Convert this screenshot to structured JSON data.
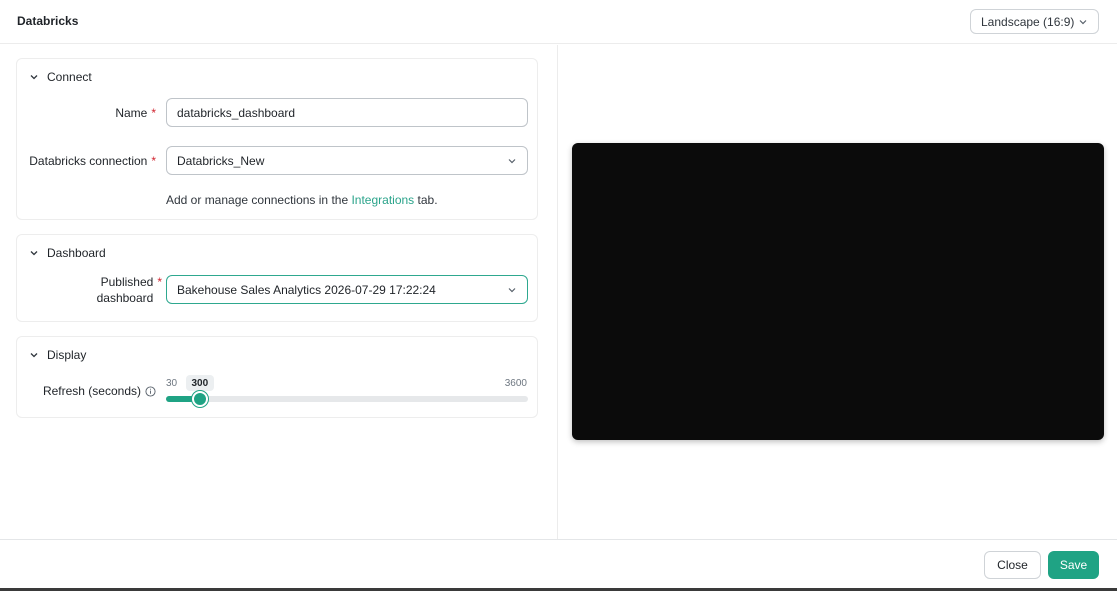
{
  "app": {
    "title": "Databricks"
  },
  "toolbar": {
    "orientation_value": "Landscape (16:9)"
  },
  "sections": {
    "connect": {
      "title": "Connect",
      "name_label": "Name",
      "name_value": "databricks_dashboard",
      "connection_label": "Databricks connection",
      "connection_value": "Databricks_New",
      "hint_prefix": "Add or manage connections in the",
      "hint_link": "Integrations",
      "hint_suffix": "tab."
    },
    "dashboard": {
      "title": "Dashboard",
      "published_label_line1": "Published",
      "published_label_line2": "dashboard",
      "published_value": "Bakehouse Sales Analytics 2026-07-29 17:22:24"
    },
    "display": {
      "title": "Display",
      "refresh_label": "Refresh (seconds)",
      "refresh_min": "30",
      "refresh_max": "3600",
      "refresh_value": "300",
      "refresh_fraction": 0.095
    }
  },
  "footer": {
    "close_label": "Close",
    "save_label": "Save"
  },
  "colors": {
    "accent": "#1fa384",
    "link": "#2aa38a",
    "required": "#d1242f",
    "preview_bg": "#0b0b0b"
  },
  "icons": [
    "chevron-down-icon",
    "info-icon"
  ]
}
